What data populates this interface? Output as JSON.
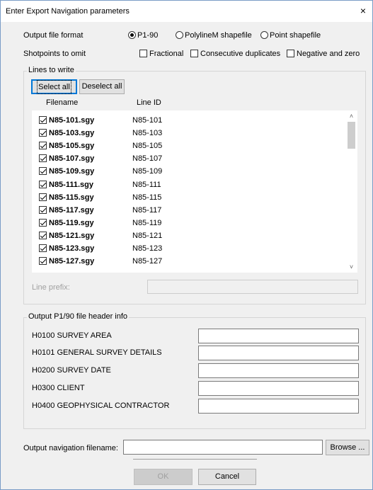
{
  "dialog": {
    "title": "Enter Export Navigation parameters",
    "close_glyph": "×"
  },
  "output_format": {
    "label": "Output file format",
    "options": [
      {
        "label": "P1-90",
        "selected": true
      },
      {
        "label": "PolylineM shapefile",
        "selected": false
      },
      {
        "label": "Point shapefile",
        "selected": false
      }
    ]
  },
  "shotpoints": {
    "label": "Shotpoints to omit",
    "options": [
      {
        "label": "Fractional",
        "checked": false
      },
      {
        "label": "Consecutive duplicates",
        "checked": false
      },
      {
        "label": "Negative and zero",
        "checked": false
      }
    ]
  },
  "lines": {
    "group_label": "Lines to write",
    "select_all_label": "Select all",
    "deselect_all_label": "Deselect all",
    "col_filename": "Filename",
    "col_line_id": "Line ID",
    "rows": [
      {
        "filename": "N85-101.sgy",
        "line_id": "N85-101",
        "checked": true
      },
      {
        "filename": "N85-103.sgy",
        "line_id": "N85-103",
        "checked": true
      },
      {
        "filename": "N85-105.sgy",
        "line_id": "N85-105",
        "checked": true
      },
      {
        "filename": "N85-107.sgy",
        "line_id": "N85-107",
        "checked": true
      },
      {
        "filename": "N85-109.sgy",
        "line_id": "N85-109",
        "checked": true
      },
      {
        "filename": "N85-111.sgy",
        "line_id": "N85-111",
        "checked": true
      },
      {
        "filename": "N85-115.sgy",
        "line_id": "N85-115",
        "checked": true
      },
      {
        "filename": "N85-117.sgy",
        "line_id": "N85-117",
        "checked": true
      },
      {
        "filename": "N85-119.sgy",
        "line_id": "N85-119",
        "checked": true
      },
      {
        "filename": "N85-121.sgy",
        "line_id": "N85-121",
        "checked": true
      },
      {
        "filename": "N85-123.sgy",
        "line_id": "N85-123",
        "checked": true
      },
      {
        "filename": "N85-127.sgy",
        "line_id": "N85-127",
        "checked": true
      }
    ],
    "line_prefix_label": "Line prefix:",
    "line_prefix_value": ""
  },
  "header_info": {
    "group_label": "Output P1/90 file header info",
    "fields": [
      {
        "label": "H0100 SURVEY AREA",
        "value": ""
      },
      {
        "label": "H0101 GENERAL SURVEY DETAILS",
        "value": ""
      },
      {
        "label": "H0200 SURVEY DATE",
        "value": ""
      },
      {
        "label": "H0300 CLIENT",
        "value": ""
      },
      {
        "label": "H0400 GEOPHYSICAL CONTRACTOR",
        "value": ""
      }
    ]
  },
  "output_nav": {
    "label": "Output navigation filename:",
    "value": "",
    "browse_label": "Browse ..."
  },
  "footer": {
    "ok_label": "OK",
    "cancel_label": "Cancel"
  }
}
